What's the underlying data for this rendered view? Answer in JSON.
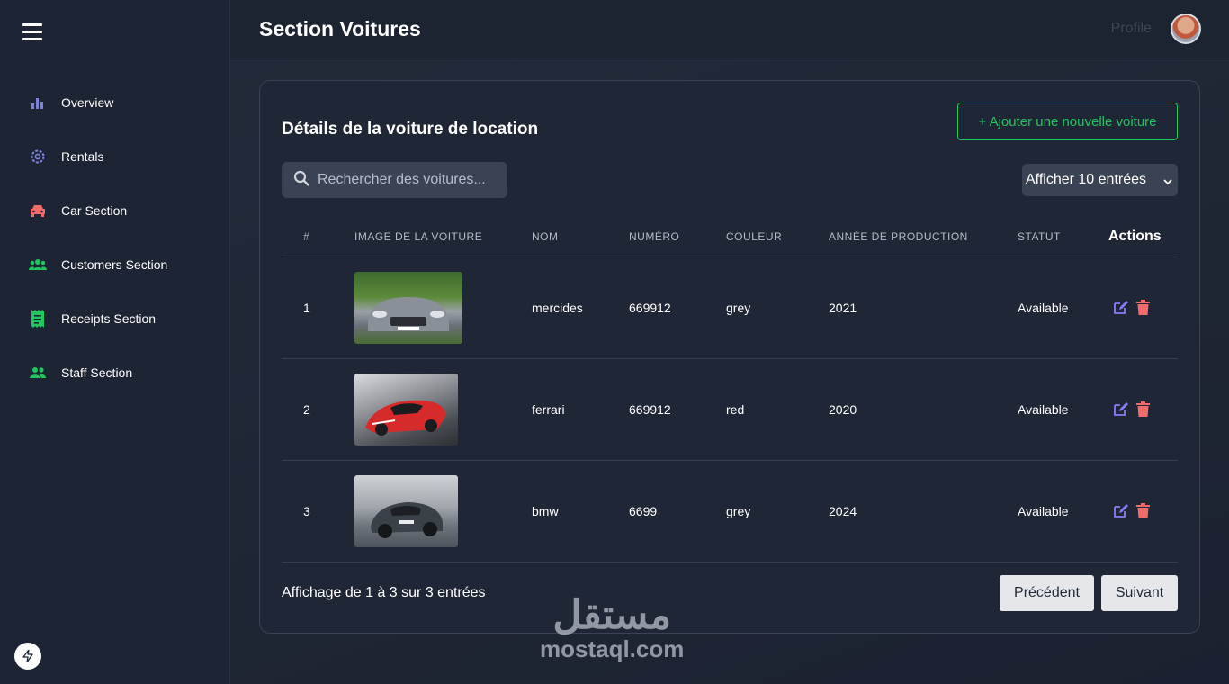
{
  "header": {
    "title": "Section Voitures",
    "profile_label": "Profile"
  },
  "sidebar": {
    "items": [
      {
        "label": "Overview",
        "icon": "bar-chart-icon",
        "color": "#7c83db"
      },
      {
        "label": "Rentals",
        "icon": "gear-icon",
        "color": "#7c83db"
      },
      {
        "label": "Car Section",
        "icon": "car-icon",
        "color": "#f26b6b"
      },
      {
        "label": "Customers Section",
        "icon": "users-icon",
        "color": "#22c55e"
      },
      {
        "label": "Receipts Section",
        "icon": "receipt-icon",
        "color": "#22c55e"
      },
      {
        "label": "Staff Section",
        "icon": "staff-icon",
        "color": "#22c55e"
      }
    ]
  },
  "card": {
    "title": "Détails de la voiture de location",
    "add_button": "+ Ajouter une nouvelle voiture",
    "search_placeholder": "Rechercher des voitures...",
    "entries_select": "Afficher 10 entrées",
    "columns": [
      "#",
      "IMAGE DE LA VOITURE",
      "NOM",
      "NUMÉRO",
      "COULEUR",
      "ANNÉE DE PRODUCTION",
      "STATUT",
      "Actions"
    ],
    "rows": [
      {
        "index": "1",
        "image": "mercedes-car-photo",
        "name": "mercides",
        "number": "669912",
        "color": "grey",
        "year": "2021",
        "status": "Available"
      },
      {
        "index": "2",
        "image": "ferrari-car-photo",
        "name": "ferrari",
        "number": "669912",
        "color": "red",
        "year": "2020",
        "status": "Available"
      },
      {
        "index": "3",
        "image": "bmw-suv-photo",
        "name": "bmw",
        "number": "6699",
        "color": "grey",
        "year": "2024",
        "status": "Available"
      }
    ],
    "footer_text": "Affichage de 1 à 3 sur 3 entrées",
    "prev_button": "Précédent",
    "next_button": "Suivant"
  },
  "watermark": {
    "arabic": "مستقل",
    "latin": "mostaql.com"
  },
  "colors": {
    "accent_green": "#22c55e",
    "edit_purple": "#8b7cf6",
    "delete_red": "#f26b6b"
  }
}
